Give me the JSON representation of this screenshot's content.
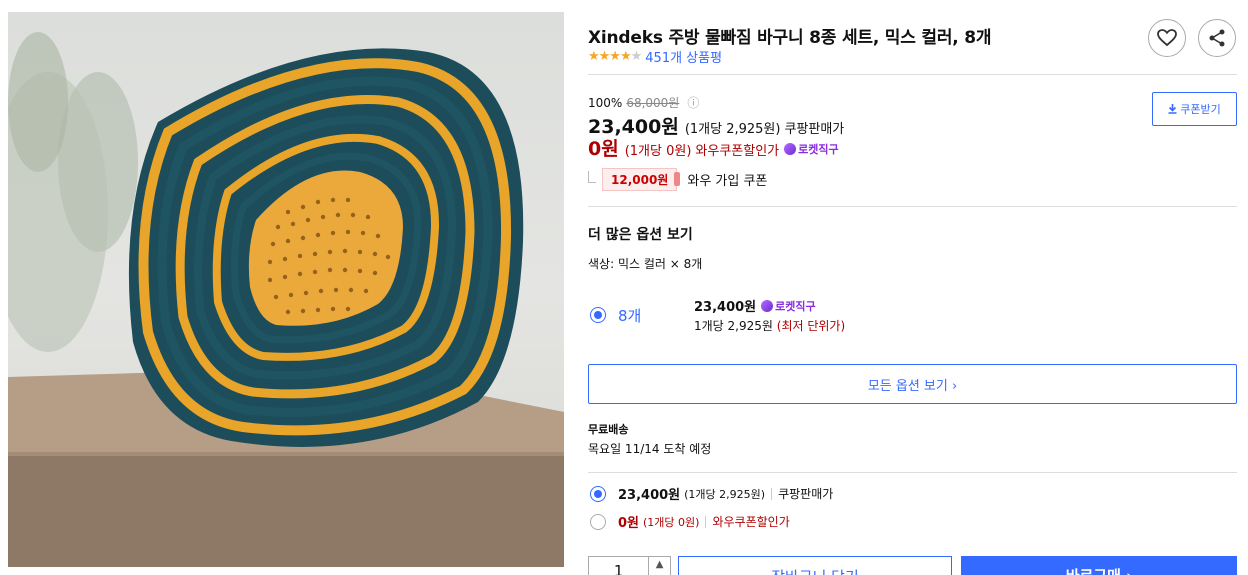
{
  "product": {
    "title": "Xindeks 주방 물빠짐 바구니 8종 세트, 믹스 컬러, 8개",
    "rating_fraction": 0.85,
    "review_count": "451개 상품평"
  },
  "pricing": {
    "discount_rate": "100%",
    "original_price": "68,000원",
    "sale_price": "23,400원",
    "sale_unit": "(1개당 2,925원)",
    "sale_label": "쿠팡판매가",
    "wow_price": "0원",
    "wow_unit": "(1개당 0원)",
    "wow_label": "와우쿠폰할인가",
    "rocket_badge": "로켓직구",
    "coupon_button": "쿠폰받기",
    "wow_coupon_amount": "12,000원",
    "wow_coupon_label": "와우 가입 쿠폰"
  },
  "options": {
    "heading": "더 많은 옵션 보기",
    "spec": "색상: 믹스 컬러 × 8개",
    "item": {
      "qty": "8개",
      "price": "23,400원",
      "rocket_badge": "로켓직구",
      "unit": "1개당 2,925원",
      "unit_note": "(최저 단위가)"
    },
    "all_button": "모든 옵션 보기 ›"
  },
  "shipping": {
    "title": "무료배송",
    "date": "목요일 11/14 도착 예정"
  },
  "payment": [
    {
      "amount": "23,400원",
      "unit": "(1개당 2,925원)",
      "label": "쿠팡판매가",
      "selected": true
    },
    {
      "amount": "0원",
      "unit": "(1개당 0원)",
      "label": "와우쿠폰할인가",
      "selected": false
    }
  ],
  "purchase": {
    "quantity": "1",
    "cart_button": "장바구니 담기",
    "buy_button": "바로구매 ›"
  },
  "colors": {
    "accent": "#346aff",
    "price_red": "#ae0000",
    "star": "#f5a623",
    "rocket_purple": "#8a2be2"
  },
  "icons": [
    "heart-icon",
    "share-icon",
    "info-icon",
    "download-icon",
    "rocket-icon",
    "chevron-up-icon"
  ]
}
